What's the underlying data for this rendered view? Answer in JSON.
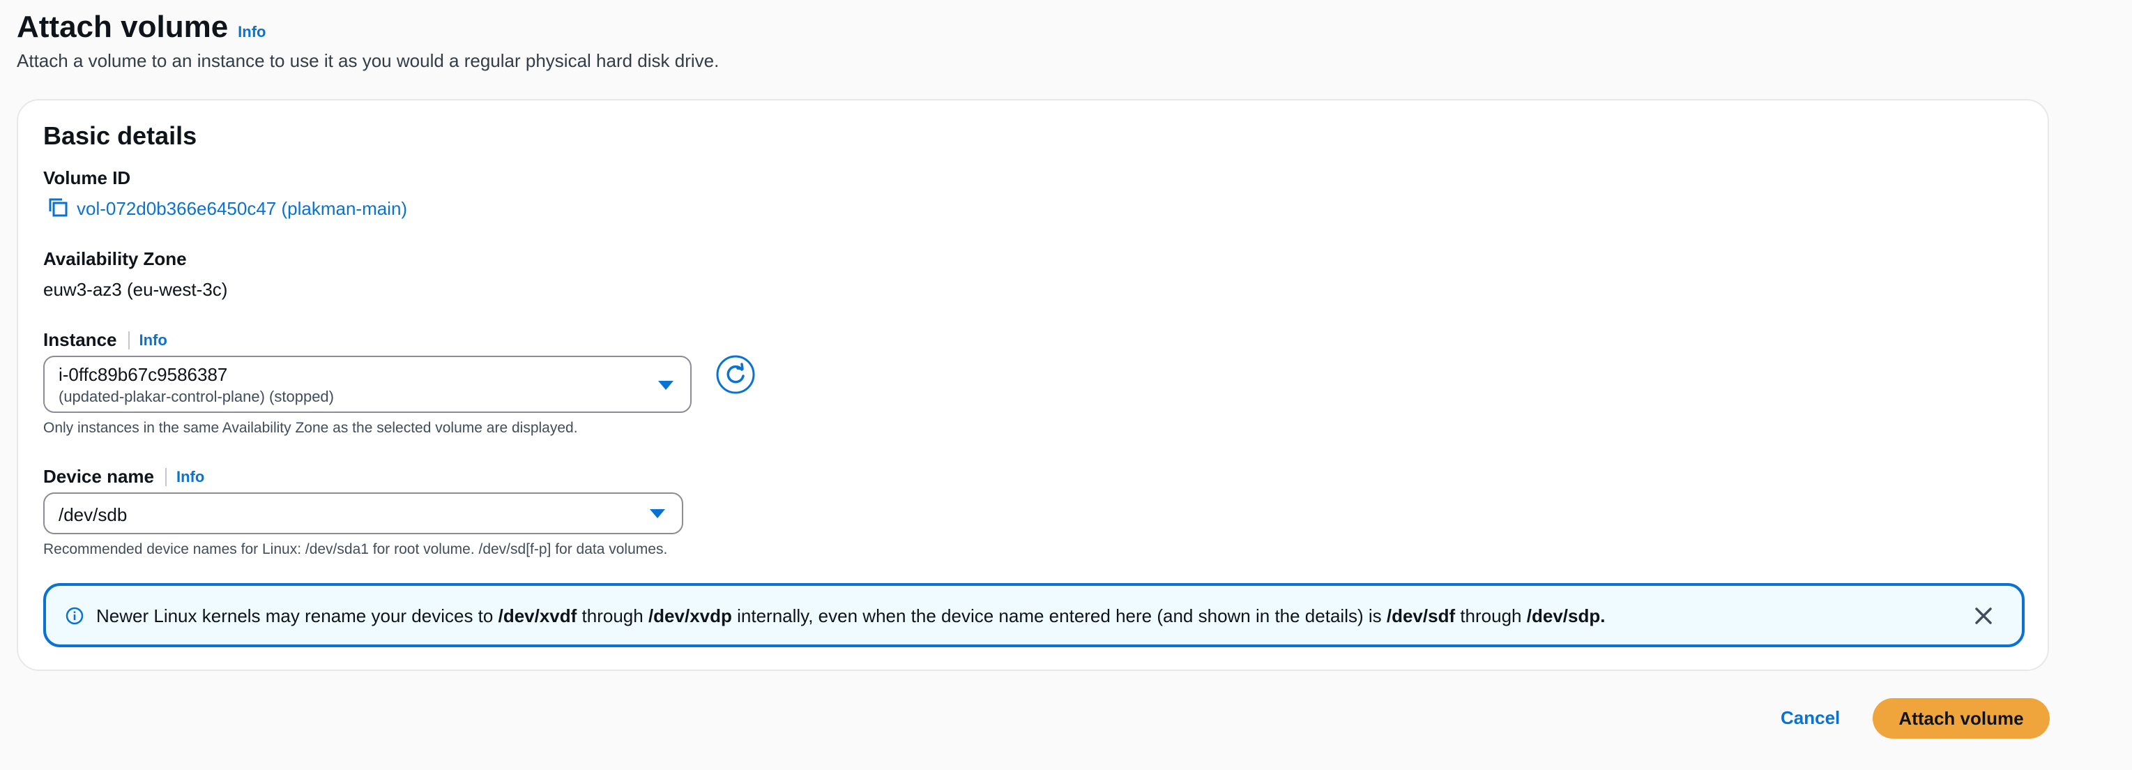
{
  "header": {
    "title": "Attach volume",
    "info": "Info",
    "description": "Attach a volume to an instance to use it as you would a regular physical hard disk drive."
  },
  "basic_details": {
    "title": "Basic details",
    "volume_id": {
      "label": "Volume ID",
      "value": "vol-072d0b366e6450c47 (plakman-main)",
      "icon": "copy-icon"
    },
    "availability_zone": {
      "label": "Availability Zone",
      "value": "euw3-az3 (eu-west-3c)"
    },
    "instance": {
      "label": "Instance",
      "info": "Info",
      "selected_id": "i-0ffc89b67c9586387",
      "selected_detail": "(updated-plakar-control-plane) (stopped)",
      "hint": "Only instances in the same Availability Zone as the selected volume are displayed.",
      "refresh_icon": "refresh-icon"
    },
    "device_name": {
      "label": "Device name",
      "info": "Info",
      "selected": "/dev/sdb",
      "hint": "Recommended device names for Linux: /dev/sda1 for root volume. /dev/sd[f-p] for data volumes."
    },
    "alert": {
      "t1": "Newer Linux kernels may rename your devices to ",
      "b1": "/dev/xvdf",
      "t2": " through ",
      "b2": "/dev/xvdp",
      "t3": " internally, even when the device name entered here (and shown in the details) is ",
      "b3": "/dev/sdf",
      "t4": " through ",
      "b4": "/dev/sdp."
    }
  },
  "footer": {
    "cancel": "Cancel",
    "attach": "Attach volume"
  },
  "colors": {
    "link": "#0972d3",
    "primary_button": "#f0a43c",
    "alert_border": "#0972d3",
    "alert_bg": "#f0fbff"
  }
}
